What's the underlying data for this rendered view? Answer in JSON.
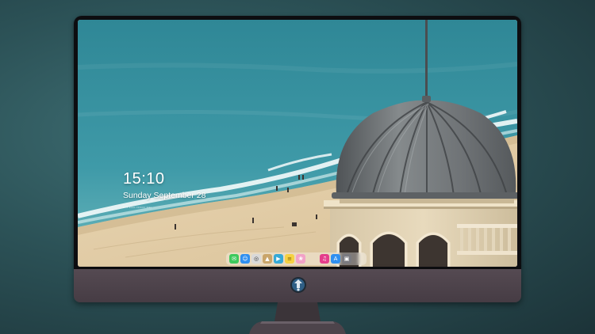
{
  "lock_screen": {
    "time": "15:10",
    "date": "Sunday September 28",
    "subline": "•••• ••••• ••••••• ••••"
  },
  "dock": {
    "apps_left": [
      {
        "name": "messages-icon",
        "glyph": "✉",
        "color": "#3ec95c"
      },
      {
        "name": "finder-icon",
        "glyph": "☺",
        "color": "#2f8ff0"
      },
      {
        "name": "chrome-icon",
        "glyph": "◎",
        "color": "#d9d9d9"
      },
      {
        "name": "maps-icon",
        "glyph": "▲",
        "color": "#c9a56a"
      },
      {
        "name": "video-editor-icon",
        "glyph": "▶",
        "color": "#36a9d6"
      },
      {
        "name": "notes-icon",
        "glyph": "≡",
        "color": "#f5d142"
      },
      {
        "name": "photos-icon",
        "glyph": "❀",
        "color": "#f2a2c7"
      }
    ],
    "apps_right": [
      {
        "name": "music-icon",
        "glyph": "♫",
        "color": "#e43d8b"
      },
      {
        "name": "app-store-icon",
        "glyph": "A",
        "color": "#2f8ff0"
      },
      {
        "name": "camera-icon",
        "glyph": "▣",
        "color": "#7a7a80"
      }
    ]
  },
  "colors": {
    "sea": "#3f9aa8",
    "sand": "#e6d2ae",
    "dome": "#6f7478",
    "bezel": "#0d0d10",
    "chin": "#4e444c"
  }
}
